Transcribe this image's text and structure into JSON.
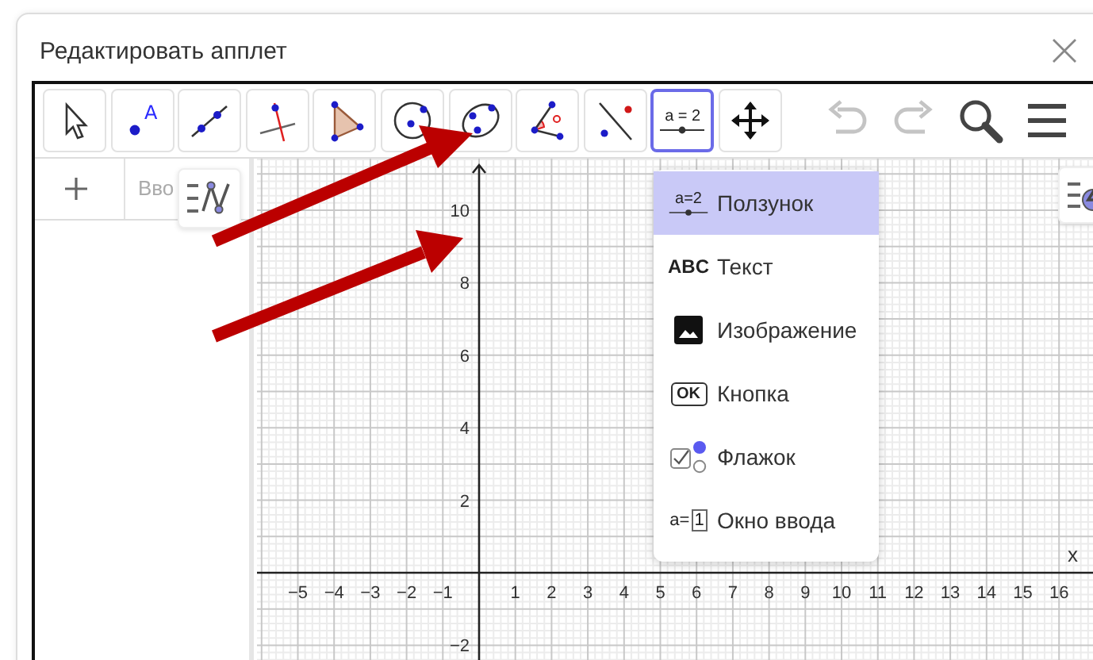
{
  "dialog": {
    "title": "Редактировать апплет"
  },
  "toolbar": {
    "tools": [
      {
        "kind": "move",
        "selected": false
      },
      {
        "kind": "point",
        "icon_text": "A",
        "selected": false
      },
      {
        "kind": "line",
        "selected": false
      },
      {
        "kind": "perpendicular",
        "selected": false
      },
      {
        "kind": "polygon",
        "selected": false
      },
      {
        "kind": "circle",
        "selected": false
      },
      {
        "kind": "ellipse",
        "selected": false
      },
      {
        "kind": "angle",
        "selected": false
      },
      {
        "kind": "reflect",
        "selected": false
      },
      {
        "kind": "slider",
        "icon_text": "a = 2",
        "selected": true
      },
      {
        "kind": "move_view",
        "selected": false
      }
    ],
    "actions": [
      {
        "kind": "undo",
        "disabled": true
      },
      {
        "kind": "redo",
        "disabled": true
      },
      {
        "kind": "search",
        "disabled": false
      },
      {
        "kind": "menu",
        "disabled": false
      }
    ]
  },
  "algebra": {
    "input_placeholder": "Вво"
  },
  "graphics": {
    "x_axis_name": "x",
    "x_labels": [
      "−5",
      "−4",
      "−3",
      "−2",
      "−1",
      "1",
      "2",
      "3",
      "4",
      "5",
      "6",
      "7",
      "8",
      "9",
      "10",
      "11",
      "12",
      "13",
      "14",
      "15",
      "16"
    ],
    "y_labels": [
      "10",
      "8",
      "6",
      "4",
      "2",
      "−2"
    ]
  },
  "tool_menu": {
    "items": [
      {
        "kind": "slider",
        "icon_text": "a=2",
        "label": "Ползунок",
        "selected": true
      },
      {
        "kind": "text",
        "icon_text": "ABC",
        "label": "Текст",
        "selected": false
      },
      {
        "kind": "image",
        "label": "Изображение",
        "selected": false
      },
      {
        "kind": "button",
        "icon_text": "OK",
        "label": "Кнопка",
        "selected": false
      },
      {
        "kind": "checkbox",
        "label": "Флажок",
        "selected": false
      },
      {
        "kind": "input",
        "icon_text": "a=",
        "icon_value": "1",
        "label": "Окно ввода",
        "selected": false
      }
    ]
  }
}
